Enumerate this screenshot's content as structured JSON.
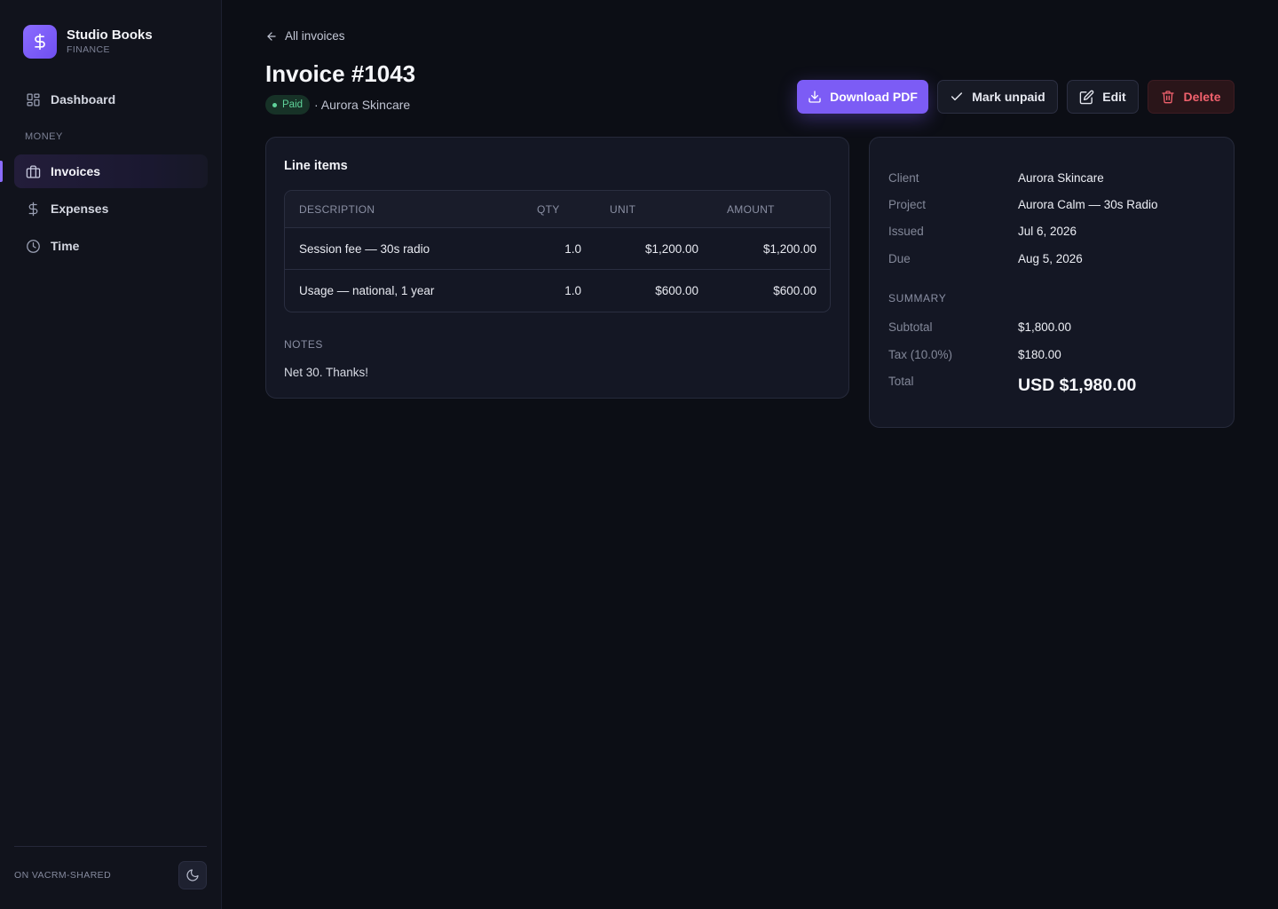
{
  "brand": {
    "name": "Studio Books",
    "subtitle": "FINANCE",
    "logo_icon": "dollar-icon",
    "accent": "#7c5cf5"
  },
  "sidebar": {
    "items": [
      {
        "label": "Dashboard",
        "icon": "dashboard-grid-icon",
        "active": false
      },
      {
        "label": "Invoices",
        "icon": "briefcase-icon",
        "active": true
      },
      {
        "label": "Expenses",
        "icon": "dollar-icon",
        "active": false
      },
      {
        "label": "Time",
        "icon": "clock-icon",
        "active": false
      }
    ],
    "section_label": "MONEY",
    "footer": "ON VACRM-SHARED",
    "theme_toggle_icon": "moon-icon"
  },
  "header": {
    "back_label": "All invoices",
    "title": "Invoice #1043",
    "status": "Paid",
    "status_color": "#5fd39a",
    "client_suffix": "· Aurora Skincare"
  },
  "actions": {
    "download": "Download PDF",
    "mark_unpaid": "Mark unpaid",
    "edit": "Edit",
    "delete": "Delete"
  },
  "line_items": {
    "title": "Line items",
    "columns": [
      "DESCRIPTION",
      "QTY",
      "UNIT",
      "AMOUNT"
    ],
    "rows": [
      {
        "description": "Session fee — 30s radio",
        "qty": "1.0",
        "unit": "$1,200.00",
        "amount": "$1,200.00"
      },
      {
        "description": "Usage — national, 1 year",
        "qty": "1.0",
        "unit": "$600.00",
        "amount": "$600.00"
      }
    ],
    "notes_label": "NOTES",
    "notes": "Net 30. Thanks!"
  },
  "details": {
    "client_label": "Client",
    "client": "Aurora Skincare",
    "project_label": "Project",
    "project": "Aurora Calm — 30s Radio",
    "issued_label": "Issued",
    "issued": "Jul 6, 2026",
    "due_label": "Due",
    "due": "Aug 5, 2026",
    "summary_label": "SUMMARY",
    "subtotal_label": "Subtotal",
    "subtotal": "$1,800.00",
    "tax_label": "Tax (10.0%)",
    "tax": "$180.00",
    "total_label": "Total",
    "total": "USD $1,980.00"
  }
}
